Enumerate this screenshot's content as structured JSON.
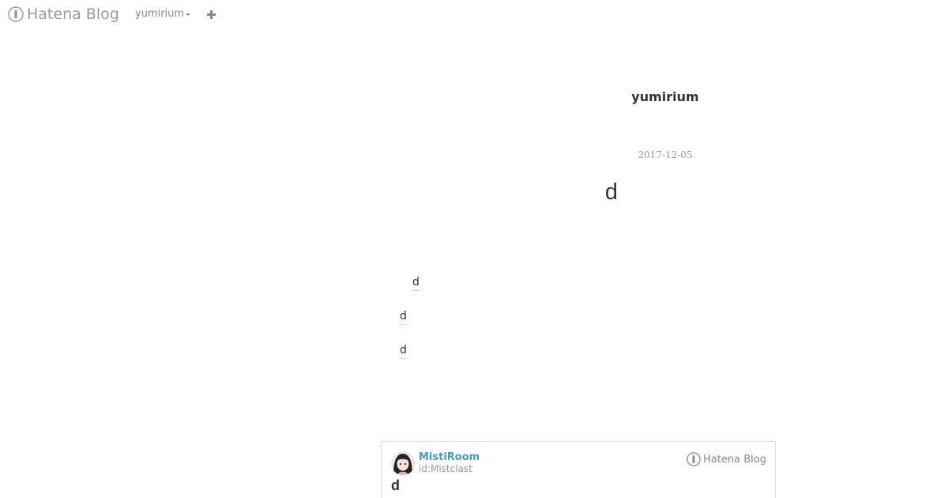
{
  "topbar": {
    "logo_text": "Hatena Blog",
    "user_menu_label": "yumirium",
    "add_icon": "plus-icon"
  },
  "blog": {
    "title": "yumirium"
  },
  "entry": {
    "date": "2017-12-05",
    "title": "d",
    "links": [
      "d",
      "d",
      "d"
    ]
  },
  "embed_card": {
    "author_name": "MistiRoom",
    "author_id": "id:Mistclast",
    "service_logo_text": "Hatena Blog",
    "title": "d"
  },
  "colors": {
    "link_blue": "#3d9cc1",
    "muted_gray": "#999999",
    "text": "#333333"
  }
}
